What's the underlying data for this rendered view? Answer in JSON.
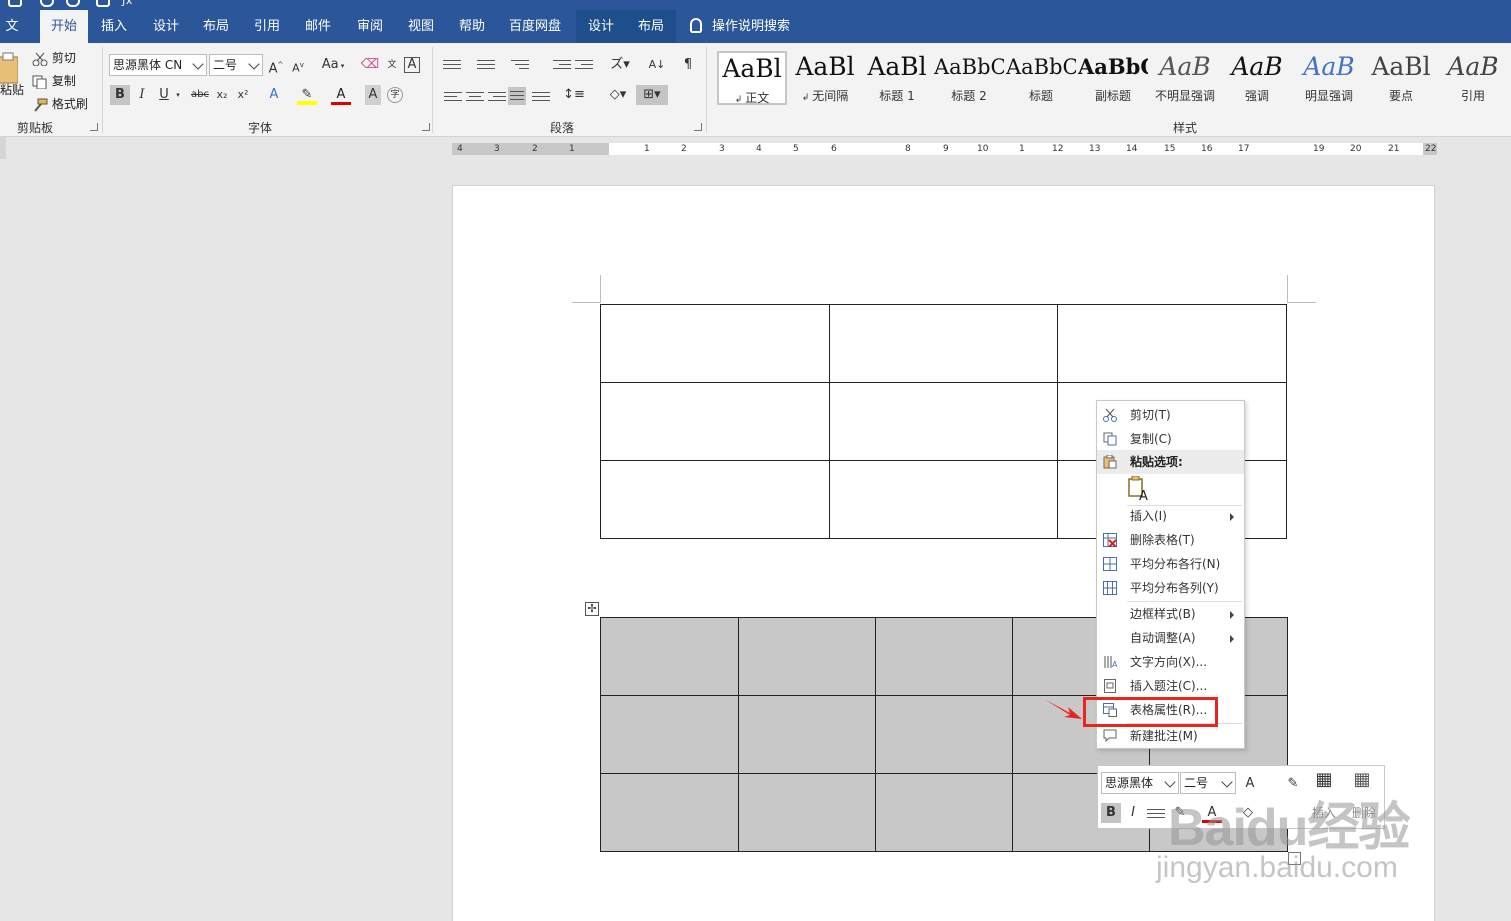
{
  "tabs": [
    {
      "label": "文件",
      "active": false
    },
    {
      "label": "开始",
      "active": true
    },
    {
      "label": "插入",
      "active": false
    },
    {
      "label": "设计",
      "active": false
    },
    {
      "label": "布局",
      "active": false
    },
    {
      "label": "引用",
      "active": false
    },
    {
      "label": "邮件",
      "active": false
    },
    {
      "label": "审阅",
      "active": false
    },
    {
      "label": "视图",
      "active": false
    },
    {
      "label": "帮助",
      "active": false
    },
    {
      "label": "百度网盘",
      "active": false
    },
    {
      "label": "设计",
      "active": false,
      "contextual": true
    },
    {
      "label": "布局",
      "active": false,
      "contextual": true
    }
  ],
  "tell_me": "操作说明搜索",
  "clipboard": {
    "paste": "粘贴",
    "cut": "剪切",
    "copy": "复制",
    "format_painter": "格式刷",
    "group_label": "剪贴板"
  },
  "font": {
    "name": "思源黑体 CN",
    "size": "二号",
    "aa_case": "Aa",
    "bold": "B",
    "italic": "I",
    "underline": "U",
    "strike": "abc",
    "subscript": "x₂",
    "superscript": "x²",
    "group_label": "字体"
  },
  "paragraph": {
    "group_label": "段落"
  },
  "styles": {
    "group_label": "样式",
    "items": [
      {
        "sample": "AaBl",
        "name": "正文",
        "current": true
      },
      {
        "sample": "AaBl",
        "name": "无间隔"
      },
      {
        "sample": "AaBl",
        "name": "标题 1"
      },
      {
        "sample": "AaBbC",
        "name": "标题 2"
      },
      {
        "sample": "AaBbC",
        "name": "标题"
      },
      {
        "sample": "AaBbC",
        "name": "副标题"
      },
      {
        "sample": "AaB",
        "name": "不明显强调"
      },
      {
        "sample": "AaB",
        "name": "强调"
      },
      {
        "sample": "AaB",
        "name": "明显强调"
      },
      {
        "sample": "AaBl",
        "name": "要点"
      },
      {
        "sample": "AaB",
        "name": "引用"
      }
    ]
  },
  "ruler": {
    "numbers": [
      "4",
      "3",
      "2",
      "1",
      "",
      "1",
      "2",
      "3",
      "4",
      "5",
      "6",
      "8",
      "9",
      "10",
      "1",
      "12",
      "13",
      "14",
      "15",
      "16",
      "17",
      "19",
      "20",
      "21",
      "22"
    ]
  },
  "context_menu": {
    "items": [
      {
        "label": "剪切(T)",
        "icon": "scissors-icon"
      },
      {
        "label": "复制(C)",
        "icon": "copy-icon"
      },
      {
        "label": "粘贴选项:",
        "icon": "paste-icon",
        "header": true
      },
      {
        "label": "插入(I)",
        "icon": "none",
        "submenu": true
      },
      {
        "label": "删除表格(T)",
        "icon": "delete-table-icon"
      },
      {
        "label": "平均分布各行(N)",
        "icon": "distribute-rows-icon"
      },
      {
        "label": "平均分布各列(Y)",
        "icon": "distribute-columns-icon"
      },
      {
        "label": "边框样式(B)",
        "icon": "none",
        "submenu": true
      },
      {
        "label": "自动调整(A)",
        "icon": "none",
        "submenu": true
      },
      {
        "label": "文字方向(X)...",
        "icon": "text-direction-icon"
      },
      {
        "label": "插入题注(C)...",
        "icon": "caption-icon"
      },
      {
        "label": "表格属性(R)...",
        "icon": "table-properties-icon",
        "highlighted": true
      },
      {
        "label": "新建批注(M)",
        "icon": "comment-icon"
      }
    ]
  },
  "mini_toolbar": {
    "font_name": "思源黑体",
    "font_size": "二号",
    "insert": "插入",
    "delete": "删除"
  },
  "watermark": {
    "line1": "Baidu经验",
    "line2": "jingyan.baidu.com"
  },
  "colors": {
    "title_bar": "#2b579a",
    "ribbon": "#f3f3f3",
    "selection_shade": "#c8c8c8",
    "highlight_red": "#e8261f"
  }
}
